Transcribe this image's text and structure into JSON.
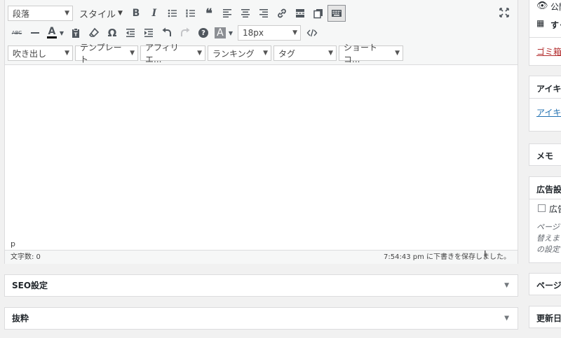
{
  "toolbar": {
    "row1": {
      "format_select": "段落",
      "style_menu": "スタイル",
      "buttons": [
        "bold",
        "italic",
        "bullet-list",
        "numbered-list",
        "blockquote",
        "align-left",
        "align-center",
        "align-right",
        "link",
        "read-more",
        "copy",
        "keyboard"
      ],
      "bold_label": "B",
      "italic_label": "I",
      "quote_label": "❝"
    },
    "row2": {
      "fontsize_select": "18px",
      "buttons": [
        "strikethrough",
        "horizontal-line",
        "text-color",
        "paste-text",
        "clear-formatting",
        "special-char",
        "outdent",
        "indent",
        "undo",
        "redo",
        "help",
        "background-color",
        "code"
      ],
      "strike_label": "ABC",
      "special_char_label": "Ω",
      "help_label": "?",
      "color_a_label": "A",
      "bg_a_label": "A"
    },
    "row3": {
      "selects": [
        "吹き出し",
        "テンプレート",
        "アフィリエ...",
        "ランキング",
        "タグ",
        "ショートコ..."
      ]
    }
  },
  "editor": {
    "path": "p",
    "word_count": "文字数: 0",
    "autosave": "7:54:43 pm に下書きを保存しました。"
  },
  "postboxes": {
    "seo": "SEO設定",
    "excerpt": "抜粋"
  },
  "sidebar": {
    "visibility": "公開",
    "schedule": "すぐ",
    "trash": "ゴミ箱へ",
    "eyecatch_title": "アイキ",
    "eyecatch_link": "アイキ",
    "memo_title": "メモ",
    "ads_title": "広告設",
    "ads_checkbox": "広告",
    "ads_desc_1": "ページ",
    "ads_desc_2": "替えま",
    "ads_desc_3": "の設定",
    "page_title": "ページ",
    "updated_title": "更新日"
  },
  "colors": {
    "accent": "#2271b1",
    "trash": "#b32d2e"
  }
}
